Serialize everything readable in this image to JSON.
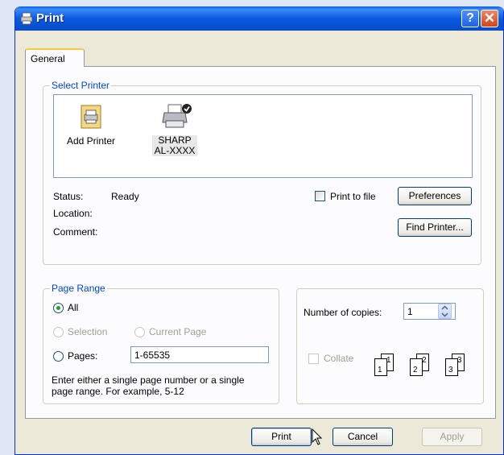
{
  "window": {
    "title": "Print",
    "help_button": "?",
    "close_button": "✕"
  },
  "tabs": [
    {
      "label": "General"
    }
  ],
  "select_printer": {
    "group_label": "Select Printer",
    "printers": [
      {
        "label": "Add Printer",
        "icon": "add-printer-icon"
      },
      {
        "label_line1": "SHARP",
        "label_line2": "AL-XXXX",
        "icon": "printer-default-icon",
        "selected": true
      }
    ],
    "status_label": "Status:",
    "status_value": "Ready",
    "location_label": "Location:",
    "location_value": "",
    "comment_label": "Comment:",
    "comment_value": "",
    "print_to_file": {
      "label": "Print to file",
      "checked": false
    },
    "preferences_button": "Preferences",
    "find_printer_button": "Find Printer..."
  },
  "page_range": {
    "group_label": "Page Range",
    "options": {
      "all": "All",
      "selection": "Selection",
      "current_page": "Current Page",
      "pages": "Pages:"
    },
    "selected": "all",
    "pages_value": "1-65535",
    "hint_line1": "Enter either a single page number or a single",
    "hint_line2": "page range.  For example, 5-12"
  },
  "copies": {
    "label": "Number of copies:",
    "value": "1",
    "collate": {
      "label": "Collate",
      "checked": false,
      "enabled": false
    },
    "collate_pages": [
      "1",
      "1",
      "2",
      "2",
      "3",
      "3"
    ]
  },
  "footer": {
    "print_button": "Print",
    "cancel_button": "Cancel",
    "apply_button": "Apply"
  }
}
